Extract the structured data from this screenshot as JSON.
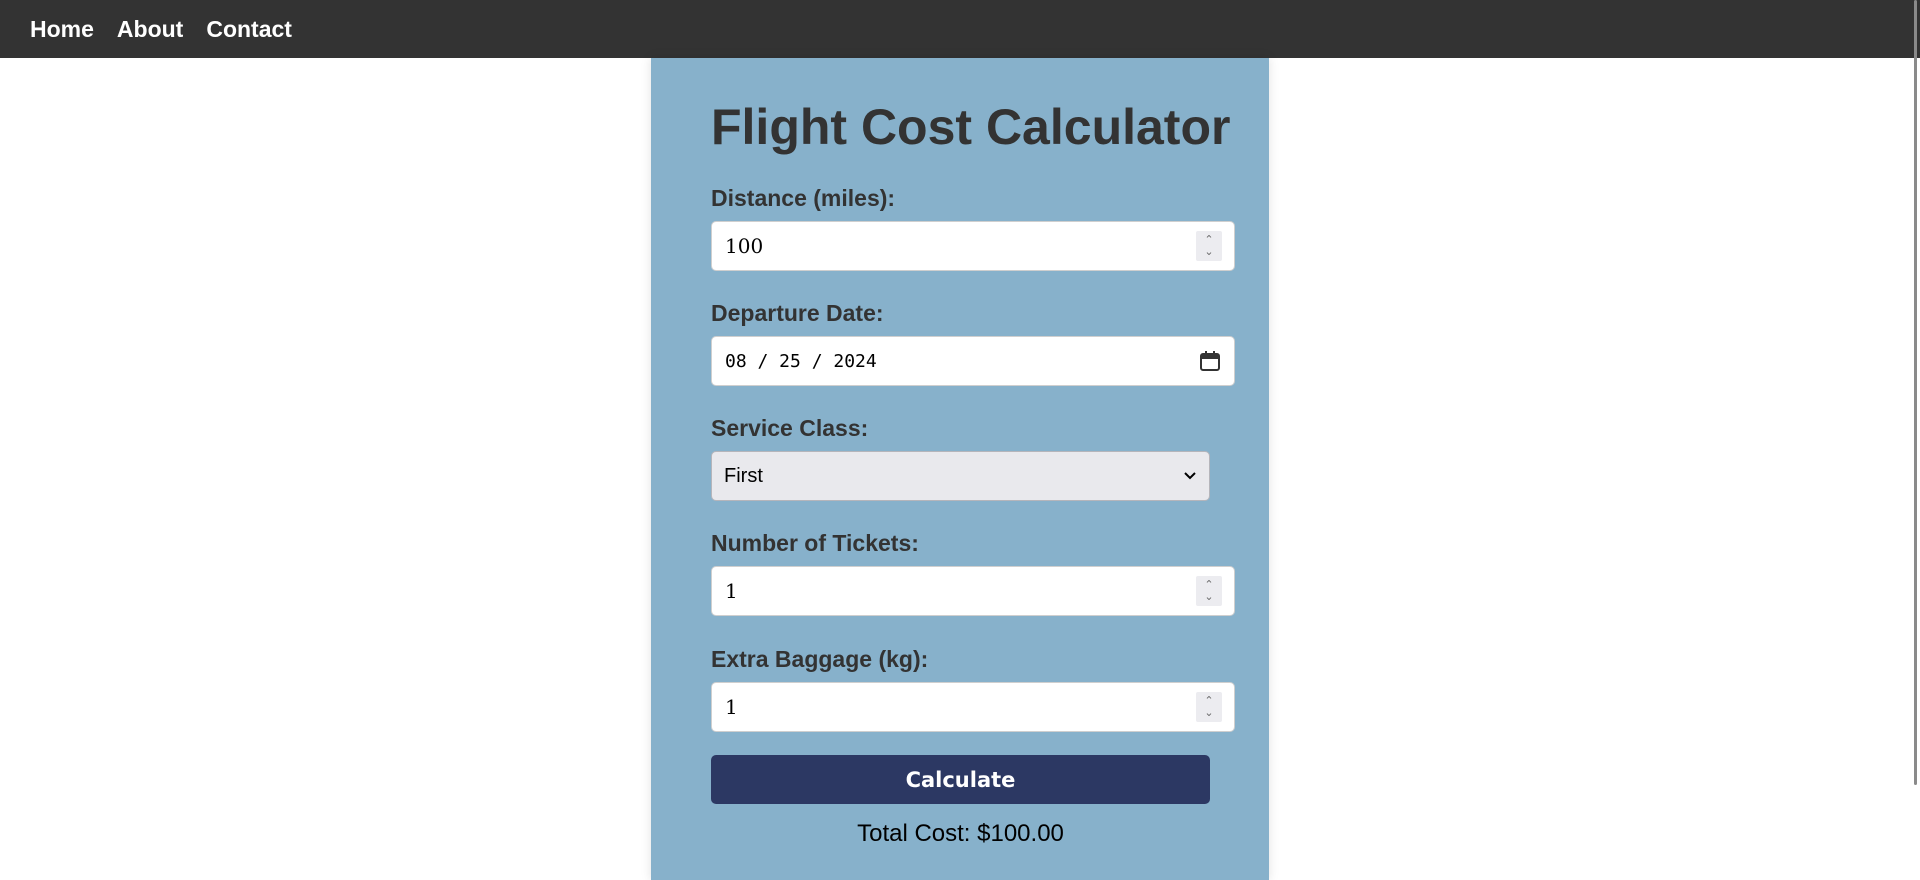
{
  "nav": {
    "links": [
      "Home",
      "About",
      "Contact"
    ]
  },
  "form": {
    "title": "Flight Cost Calculator",
    "distance": {
      "label": "Distance (miles):",
      "value": "100"
    },
    "departure_date": {
      "label": "Departure Date:",
      "value": "08 / 25 / 2024"
    },
    "service_class": {
      "label": "Service Class:",
      "selected": "First"
    },
    "tickets": {
      "label": "Number of Tickets:",
      "value": "1"
    },
    "baggage": {
      "label": "Extra Baggage (kg):",
      "value": "1"
    },
    "calculate_label": "Calculate",
    "total_cost": "Total Cost: $100.00"
  },
  "colors": {
    "navbar": "#333333",
    "card_background": "#87b1cb",
    "button": "#2c3863"
  }
}
